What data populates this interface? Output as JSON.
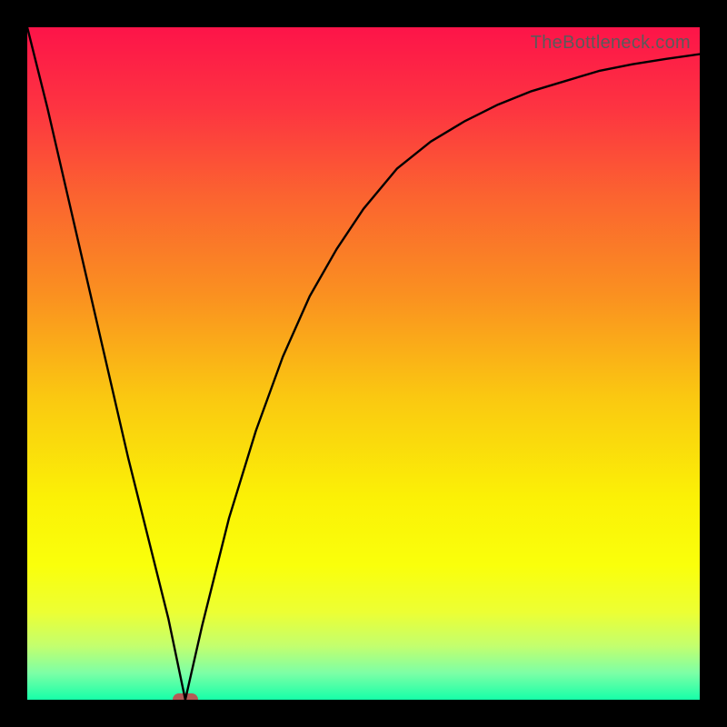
{
  "watermark": "TheBottleneck.com",
  "chart_data": {
    "type": "line",
    "title": "",
    "xlabel": "",
    "ylabel": "",
    "xlim": [
      0,
      100
    ],
    "ylim": [
      0,
      100
    ],
    "series": [
      {
        "name": "bottleneck-curve",
        "x": [
          0,
          3,
          6,
          9,
          12,
          15,
          18,
          21,
          23.5,
          26,
          30,
          34,
          38,
          42,
          46,
          50,
          55,
          60,
          65,
          70,
          75,
          80,
          85,
          90,
          95,
          100
        ],
        "values": [
          100,
          88,
          75,
          62,
          49,
          36,
          24,
          12,
          0,
          11,
          27,
          40,
          51,
          60,
          67,
          73,
          79,
          83,
          86,
          88.5,
          90.5,
          92,
          93.5,
          94.5,
          95.3,
          96
        ]
      }
    ],
    "marker": {
      "x": 23.5,
      "y": 0,
      "color": "#b45a56"
    },
    "gradient_stops": [
      {
        "pct": 0,
        "color": "#fd1449"
      },
      {
        "pct": 12,
        "color": "#fd3441"
      },
      {
        "pct": 25,
        "color": "#fb6330"
      },
      {
        "pct": 40,
        "color": "#fa9120"
      },
      {
        "pct": 55,
        "color": "#fac811"
      },
      {
        "pct": 70,
        "color": "#fbf106"
      },
      {
        "pct": 80,
        "color": "#faff0b"
      },
      {
        "pct": 87,
        "color": "#ecff34"
      },
      {
        "pct": 92,
        "color": "#c3ff6e"
      },
      {
        "pct": 96,
        "color": "#7dffa6"
      },
      {
        "pct": 100,
        "color": "#16ffa8"
      }
    ]
  }
}
